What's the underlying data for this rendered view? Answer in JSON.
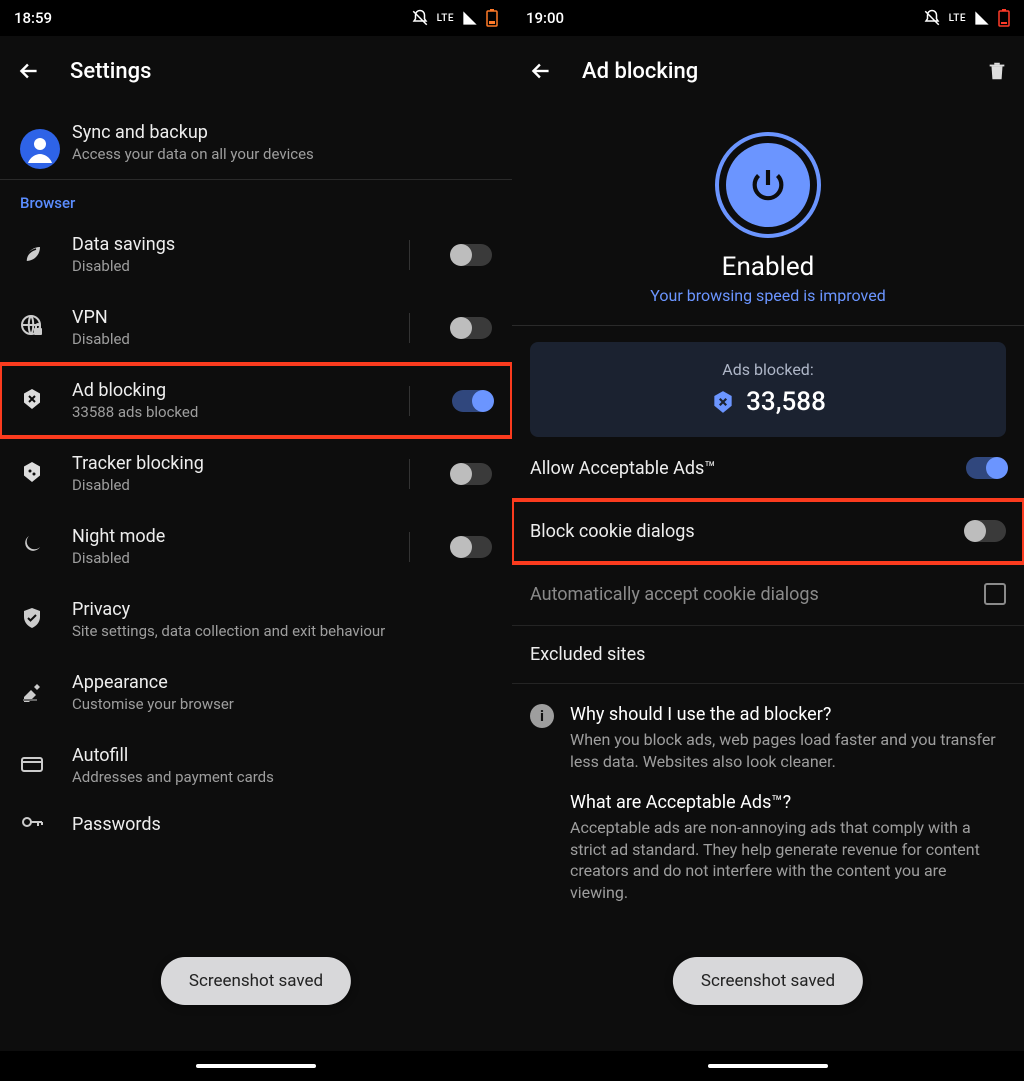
{
  "left": {
    "status_time": "18:59",
    "header_title": "Settings",
    "sync": {
      "title": "Sync and backup",
      "sub": "Access your data on all your devices"
    },
    "section": "Browser",
    "items": {
      "data_savings": {
        "title": "Data savings",
        "sub": "Disabled"
      },
      "vpn": {
        "title": "VPN",
        "sub": "Disabled"
      },
      "ad_blocking": {
        "title": "Ad blocking",
        "sub": "33588 ads blocked"
      },
      "tracker": {
        "title": "Tracker blocking",
        "sub": "Disabled"
      },
      "night": {
        "title": "Night mode",
        "sub": "Disabled"
      },
      "privacy": {
        "title": "Privacy",
        "sub": "Site settings, data collection and exit behaviour"
      },
      "appearance": {
        "title": "Appearance",
        "sub": "Customise your browser"
      },
      "autofill": {
        "title": "Autofill",
        "sub": "Addresses and payment cards"
      },
      "passwords": {
        "title": "Passwords"
      }
    },
    "toast": "Screenshot saved"
  },
  "right": {
    "status_time": "19:00",
    "header_title": "Ad blocking",
    "hero": {
      "title": "Enabled",
      "sub": "Your browsing speed is improved"
    },
    "card": {
      "label": "Ads blocked:",
      "value": "33,588"
    },
    "rows": {
      "allow": "Allow Acceptable Ads™",
      "block_cookie": "Block cookie dialogs",
      "auto_cookie": "Automatically accept cookie dialogs",
      "excluded": "Excluded sites"
    },
    "info1": {
      "title": "Why should I use the ad blocker?",
      "text": "When you block ads, web pages load faster and you transfer less data. Websites also look cleaner."
    },
    "info2": {
      "title": "What are Acceptable Ads™?",
      "text": "Acceptable ads are non-annoying ads that comply with a strict ad standard. They help generate revenue for content creators and do not interfere with the content you are viewing."
    },
    "toast": "Screenshot saved"
  },
  "lte": "LTE"
}
